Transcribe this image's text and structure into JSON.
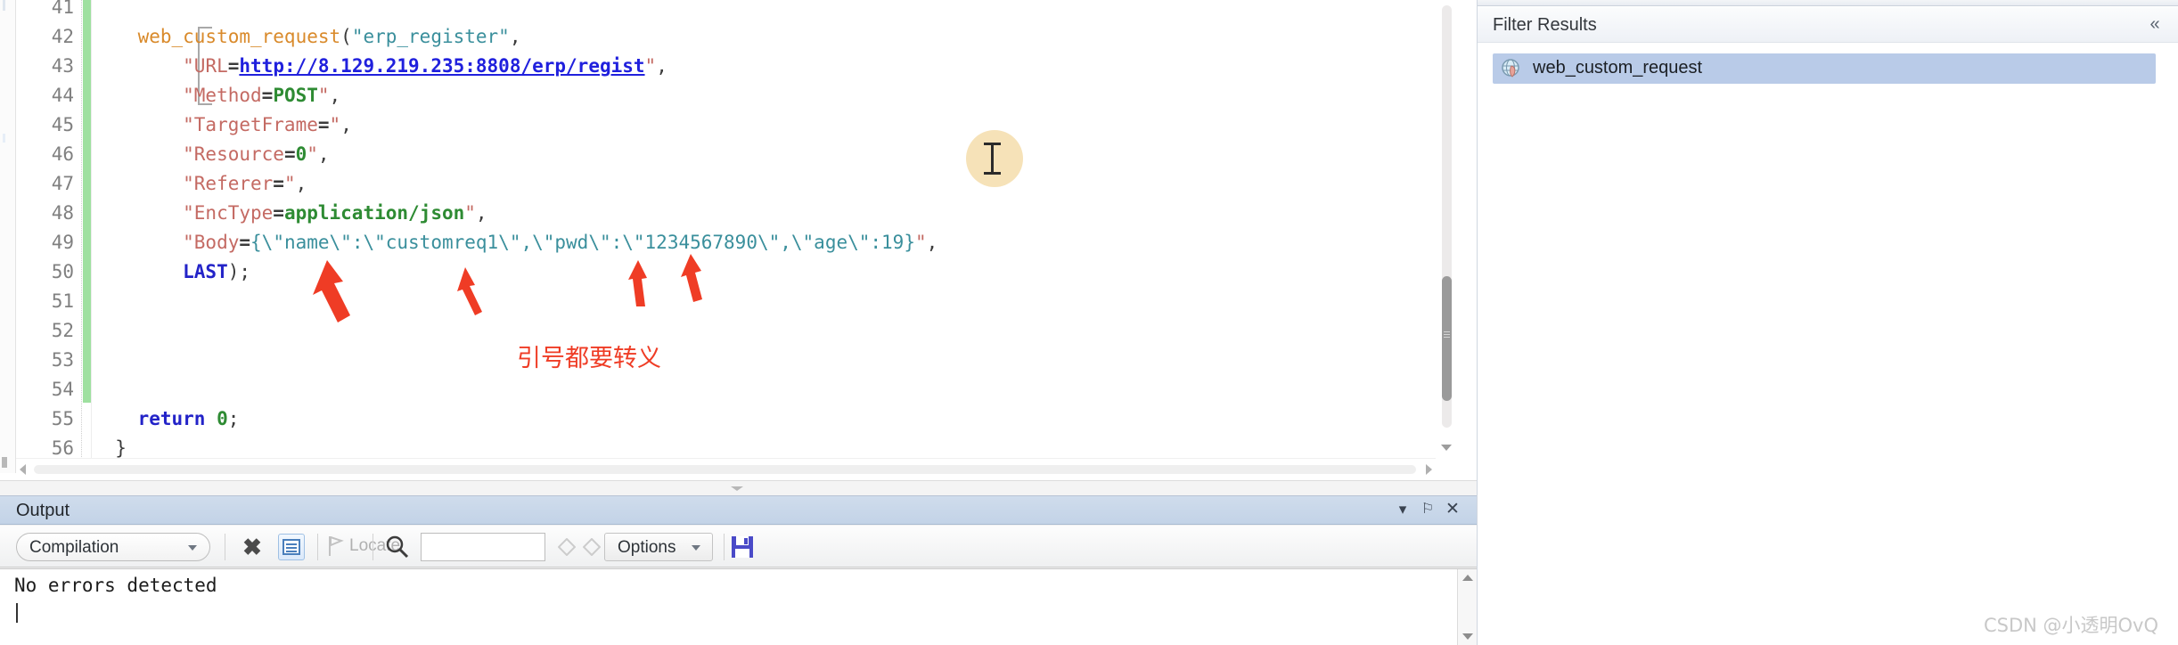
{
  "editor": {
    "line_numbers": [
      "41",
      "42",
      "43",
      "44",
      "45",
      "46",
      "47",
      "48",
      "49",
      "50",
      "51",
      "52",
      "53",
      "54",
      "55",
      "56"
    ],
    "lines": [
      {
        "n": "41",
        "segments": []
      },
      {
        "n": "42",
        "segments": [
          {
            "t": "    web_custom_request",
            "c": "c-fn"
          },
          {
            "t": "(",
            "c": "c-punct"
          },
          {
            "t": "\"erp_register\"",
            "c": "c-str"
          },
          {
            "t": ",",
            "c": "c-punct"
          }
        ]
      },
      {
        "n": "43",
        "segments": [
          {
            "t": "        \"",
            "c": "c-strred"
          },
          {
            "t": "URL",
            "c": "c-strred"
          },
          {
            "t": "=",
            "c": "c-op"
          },
          {
            "t": "http://8.129.219.235:8808/erp/regist",
            "c": "c-link"
          },
          {
            "t": "\"",
            "c": "c-strred"
          },
          {
            "t": ",",
            "c": "c-punct"
          }
        ]
      },
      {
        "n": "44",
        "segments": [
          {
            "t": "        \"Method",
            "c": "c-strred"
          },
          {
            "t": "=",
            "c": "c-op"
          },
          {
            "t": "POST",
            "c": "c-green"
          },
          {
            "t": "\"",
            "c": "c-strred"
          },
          {
            "t": ",",
            "c": "c-punct"
          }
        ]
      },
      {
        "n": "45",
        "segments": [
          {
            "t": "        \"TargetFrame",
            "c": "c-strred"
          },
          {
            "t": "=",
            "c": "c-op"
          },
          {
            "t": "\"",
            "c": "c-strred"
          },
          {
            "t": ",",
            "c": "c-punct"
          }
        ]
      },
      {
        "n": "46",
        "segments": [
          {
            "t": "        \"Resource",
            "c": "c-strred"
          },
          {
            "t": "=",
            "c": "c-op"
          },
          {
            "t": "0",
            "c": "c-num"
          },
          {
            "t": "\"",
            "c": "c-strred"
          },
          {
            "t": ",",
            "c": "c-punct"
          }
        ]
      },
      {
        "n": "47",
        "segments": [
          {
            "t": "        \"Referer",
            "c": "c-strred"
          },
          {
            "t": "=",
            "c": "c-op"
          },
          {
            "t": "\"",
            "c": "c-strred"
          },
          {
            "t": ",",
            "c": "c-punct"
          }
        ]
      },
      {
        "n": "48",
        "segments": [
          {
            "t": "        \"EncType",
            "c": "c-strred"
          },
          {
            "t": "=",
            "c": "c-op"
          },
          {
            "t": "application/json",
            "c": "c-green"
          },
          {
            "t": "\"",
            "c": "c-strred"
          },
          {
            "t": ",",
            "c": "c-punct"
          }
        ]
      },
      {
        "n": "49",
        "segments": [
          {
            "t": "        \"Body",
            "c": "c-strred"
          },
          {
            "t": "=",
            "c": "c-op"
          },
          {
            "t": "{\\\"name\\\":\\\"customreq1\\\",\\\"pwd\\\":\\\"1234567890\\\",\\\"age\\\":19}",
            "c": "c-str"
          },
          {
            "t": "\"",
            "c": "c-strred"
          },
          {
            "t": ",",
            "c": "c-punct"
          }
        ]
      },
      {
        "n": "50",
        "segments": [
          {
            "t": "        LAST",
            "c": "c-kw"
          },
          {
            "t": ");",
            "c": "c-punct"
          }
        ]
      },
      {
        "n": "51",
        "segments": []
      },
      {
        "n": "52",
        "segments": []
      },
      {
        "n": "53",
        "segments": []
      },
      {
        "n": "54",
        "segments": []
      },
      {
        "n": "55",
        "segments": [
          {
            "t": "    return",
            "c": "c-kw"
          },
          {
            "t": " ",
            "c": "c-plain"
          },
          {
            "t": "0",
            "c": "c-num"
          },
          {
            "t": ";",
            "c": "c-punct"
          }
        ]
      },
      {
        "n": "56",
        "segments": [
          {
            "t": "  }",
            "c": "c-punct"
          }
        ]
      }
    ],
    "raw_text": [
      "",
      "    web_custom_request(\"erp_register\",",
      "        \"URL=http://8.129.219.235:8808/erp/regist\",",
      "        \"Method=POST\",",
      "        \"TargetFrame=\",",
      "        \"Resource=0\",",
      "        \"Referer=\",",
      "        \"EncType=application/json\",",
      "        \"Body={\\\"name\\\":\\\"customreq1\\\",\\\"pwd\\\":\\\"1234567890\\\",\\\"age\\\":19}\",",
      "        LAST);",
      "",
      "",
      "",
      "",
      "    return 0;",
      "  }"
    ]
  },
  "annotation": {
    "note_text": "引号都要转义",
    "color": "#ef3c25",
    "arrow_count": 4
  },
  "filter_panel": {
    "title": "Filter Results",
    "collapse_glyph": "«",
    "items": [
      {
        "label": "web_custom_request",
        "icon": "globe-icon",
        "selected": true
      }
    ]
  },
  "output_panel": {
    "title": "Output",
    "titlebar_buttons": [
      {
        "name": "dropdown",
        "glyph": "▾"
      },
      {
        "name": "pin",
        "glyph": "⚐"
      },
      {
        "name": "close",
        "glyph": "✕"
      }
    ],
    "toolbar": {
      "source_combo_value": "Compilation",
      "clear_label": "✖",
      "wrap_label": "word-wrap",
      "locate_label": "Locate",
      "search_icon": "magnifier-icon",
      "search_value": "",
      "search_placeholder": "",
      "prev_label": "◇",
      "next_label": "◇",
      "options_label": "Options",
      "save_label": "save-icon"
    },
    "content": "No errors detected"
  },
  "watermark": {
    "text": "CSDN @小透明OvQ"
  },
  "colors": {
    "change_bar": "#9fe0a0",
    "selection": "#b9cbe8",
    "annotation_red": "#ef3c25",
    "output_titlebar": "#c3d3e7",
    "link": "#2020dd"
  }
}
